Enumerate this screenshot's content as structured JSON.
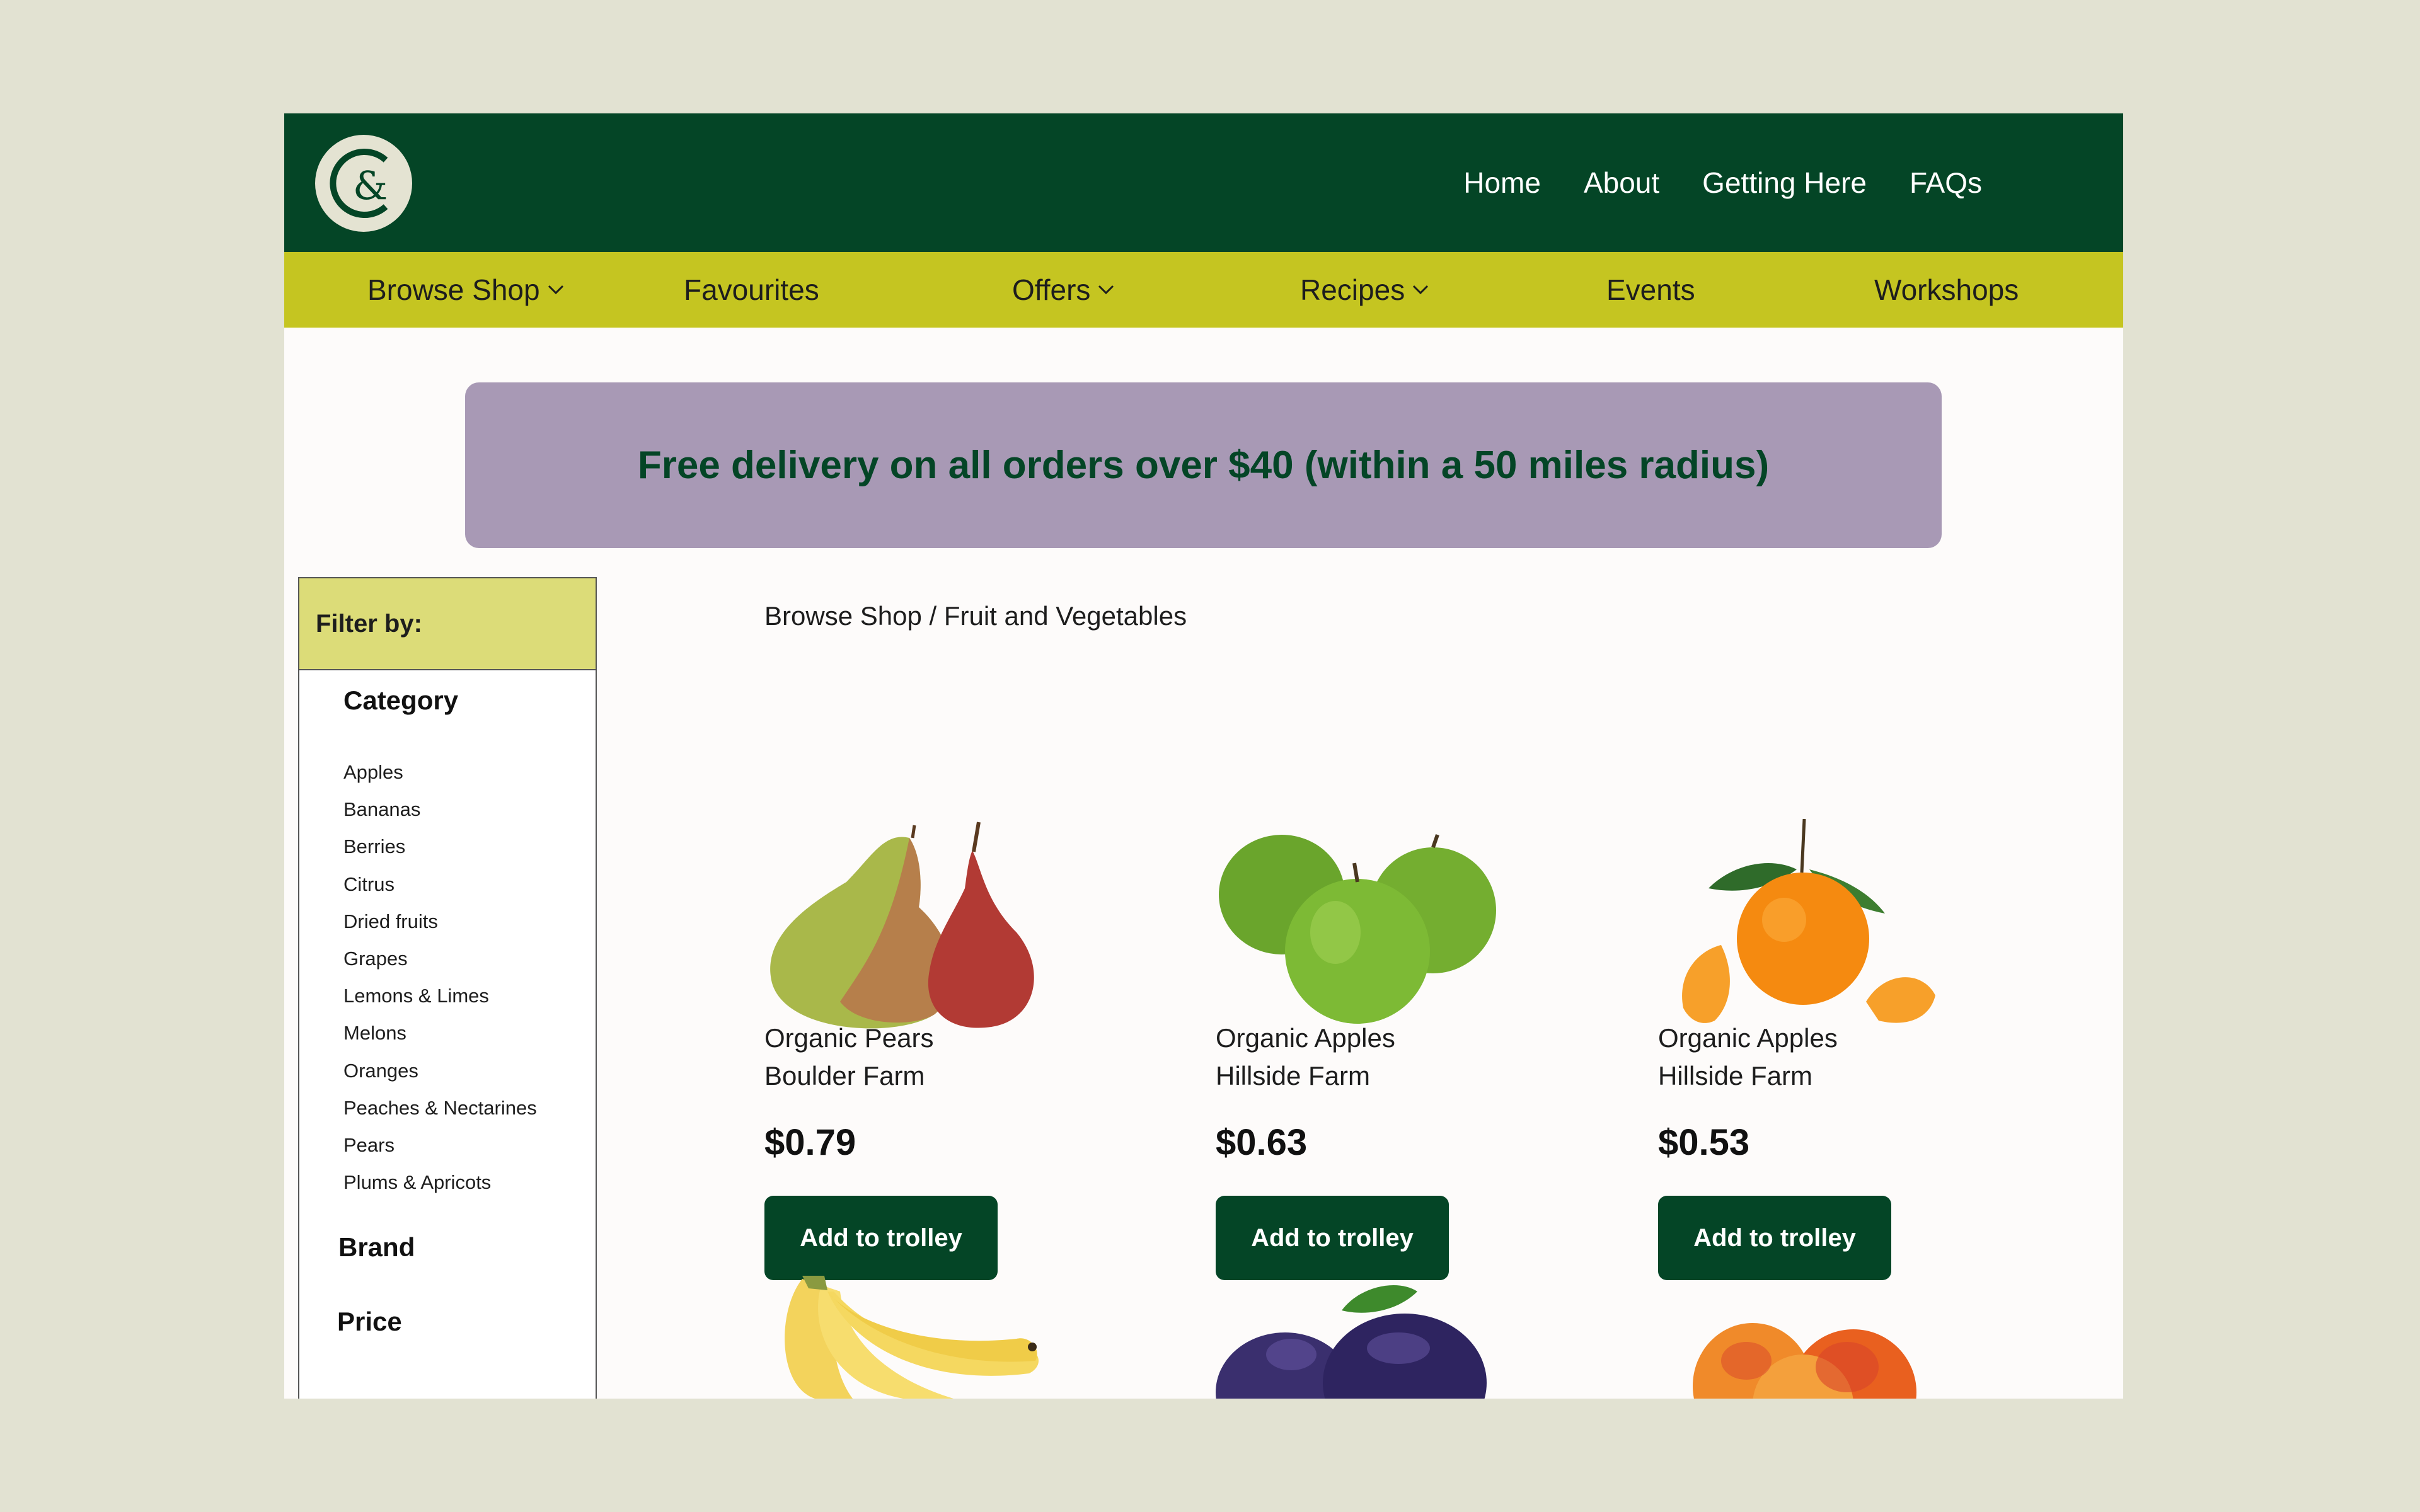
{
  "header": {
    "logo": "C& logo",
    "nav": [
      "Home",
      "About",
      "Getting Here",
      "FAQs"
    ]
  },
  "category_nav": [
    {
      "label": "Browse Shop",
      "dropdown": true
    },
    {
      "label": "Favourites",
      "dropdown": false
    },
    {
      "label": "Offers",
      "dropdown": true
    },
    {
      "label": "Recipes",
      "dropdown": true
    },
    {
      "label": "Events",
      "dropdown": false
    },
    {
      "label": "Workshops",
      "dropdown": false
    }
  ],
  "promo": {
    "text": "Free delivery on all orders over $40 (within a 50 miles radius)"
  },
  "filter": {
    "title": "Filter by:",
    "category_title": "Category",
    "categories": [
      "Apples",
      "Bananas",
      "Berries",
      "Citrus",
      "Dried fruits",
      "Grapes",
      "Lemons & Limes",
      "Melons",
      "Oranges",
      "Peaches & Nectarines",
      "Pears",
      "Plums & Apricots"
    ],
    "brand_title": "Brand",
    "price_title": "Price"
  },
  "breadcrumb": "Browse Shop / Fruit and Vegetables",
  "products": [
    {
      "name": "Organic Pears",
      "farm": "Boulder Farm",
      "price": "$0.79",
      "button": "Add to trolley",
      "image": "pears"
    },
    {
      "name": "Organic Apples",
      "farm": "Hillside Farm",
      "price": "$0.63",
      "button": "Add to trolley",
      "image": "green-apples"
    },
    {
      "name": "Organic Apples",
      "farm": "Hillside Farm",
      "price": "$0.53",
      "button": "Add to trolley",
      "image": "mandarin"
    }
  ],
  "products_partial": [
    {
      "image": "bananas"
    },
    {
      "image": "plums"
    },
    {
      "image": "peaches"
    }
  ],
  "colors": {
    "header": "#044526",
    "category_bar": "#c5c521",
    "promo": "#a899b5",
    "filter_head": "#dcdc78",
    "button": "#044526"
  }
}
